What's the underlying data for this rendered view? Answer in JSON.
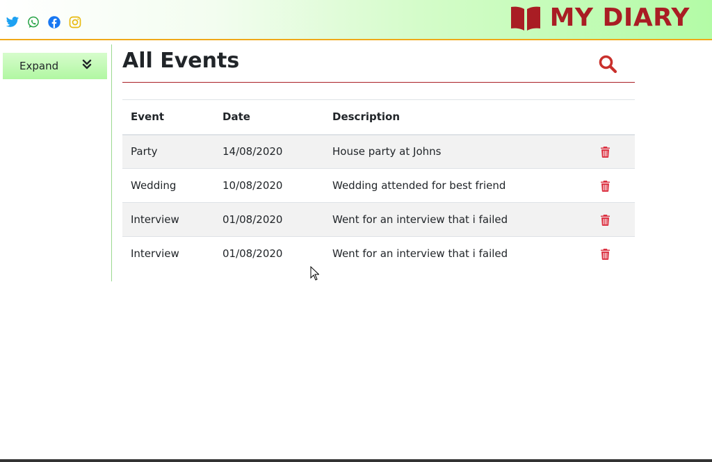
{
  "header": {
    "brand_title": "MY DIARY",
    "brand_icon": "book-open-icon",
    "brand_color": "#a91d24",
    "social_icons": [
      "twitter-icon",
      "whatsapp-icon",
      "facebook-icon",
      "instagram-icon"
    ]
  },
  "sidebar": {
    "expand_label": "Expand",
    "expand_icon": "chevrons-down-icon"
  },
  "main": {
    "title": "All Events",
    "search_icon": "search-icon",
    "table": {
      "columns": [
        "Event",
        "Date",
        "Description",
        ""
      ],
      "rows": [
        {
          "event": "Party",
          "date": "14/08/2020",
          "description": "House party at Johns"
        },
        {
          "event": "Wedding",
          "date": "10/08/2020",
          "description": "Wedding attended for best friend"
        },
        {
          "event": "Interview",
          "date": "01/08/2020",
          "description": "Went for an interview that i failed"
        },
        {
          "event": "Interview",
          "date": "01/08/2020",
          "description": "Went for an interview that i failed"
        }
      ],
      "row_action_icon": "trash-icon"
    }
  }
}
